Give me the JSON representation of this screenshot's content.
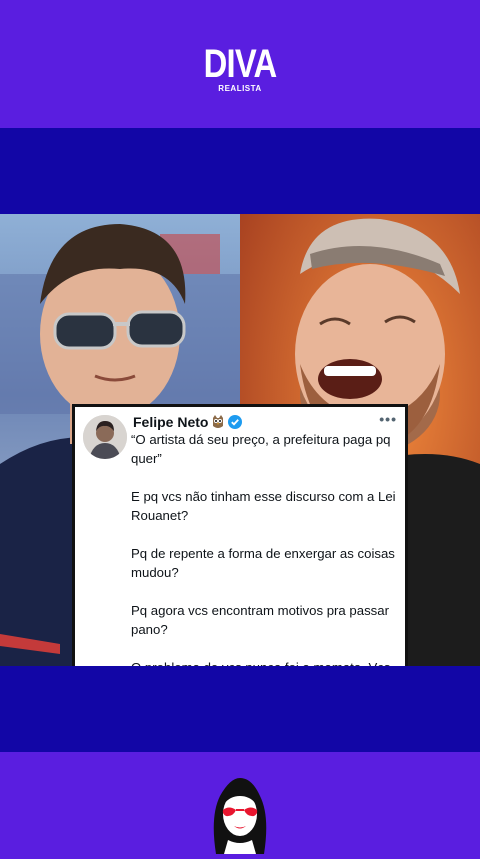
{
  "brand": {
    "name": "DIVA",
    "subtitle": "REALISTA"
  },
  "tweet": {
    "author_name": "Felipe Neto",
    "paragraphs": [
      "“O artista dá seu preço, a prefeitura paga pq quer”",
      "E pq vcs não tinham esse discurso com a Lei Rouanet?",
      "Pq de repente a forma de enxergar as coisas mudou?",
      "Pq agora vcs encontram motivos pra passar pano?",
      "O problema de vcs nunca foi a mamata. Vcs querem a mamata, só q de vocês"
    ],
    "more_icon": "more-options-icon"
  },
  "colors": {
    "brand_purple": "#5a1ee0",
    "band_blue": "#1206a6",
    "verified_blue": "#1d9bf0"
  }
}
